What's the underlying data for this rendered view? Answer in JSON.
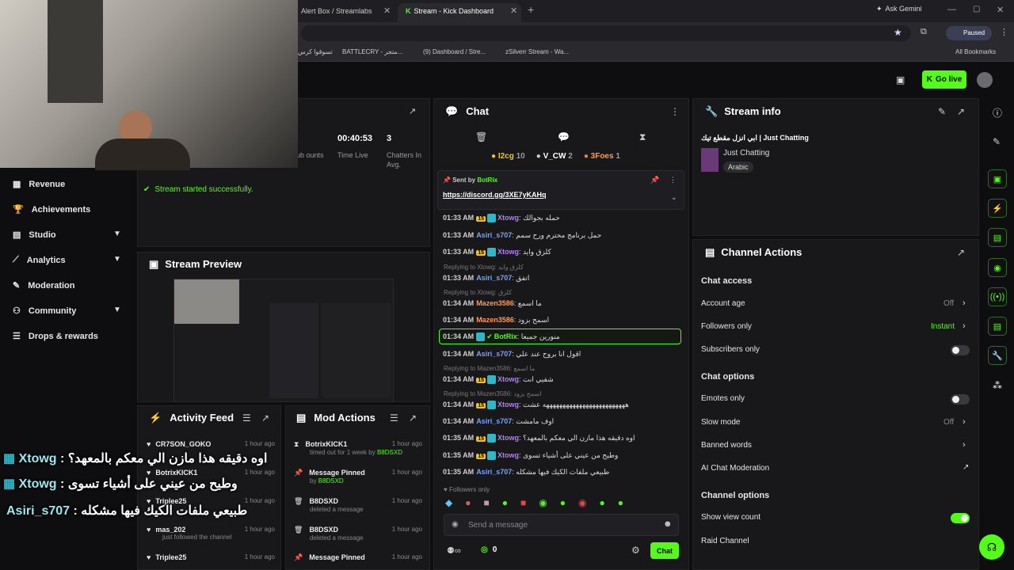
{
  "browser": {
    "tabs": [
      {
        "label": "Alert Box / Streamlabs"
      },
      {
        "label": "Stream - Kick Dashboard"
      }
    ],
    "ask_gemini": "Ask Gemini",
    "profile_status": "Paused",
    "bookmarks": [
      "تسوقوا كرس",
      "BATTLECRY - متجر...",
      "(9) Dashboard / Stre...",
      "zSilverr Stream - Wa..."
    ],
    "all_bookmarks": "All Bookmarks"
  },
  "header": {
    "go_live": "Go live"
  },
  "stats": {
    "time_value": "00:40:53",
    "time_label": "Time Live",
    "chatters_value": "3",
    "chatters_label": "Chatters In Avg.",
    "sub_label": "ub ounts"
  },
  "sidebar": {
    "items": [
      {
        "label": "Revenue"
      },
      {
        "label": "Achievements"
      },
      {
        "label": "Studio"
      },
      {
        "label": "Analytics"
      },
      {
        "label": "Moderation"
      },
      {
        "label": "Community"
      },
      {
        "label": "Drops & rewards"
      }
    ]
  },
  "notice": "Stream started successfully.",
  "preview": {
    "title": "Stream Preview"
  },
  "activity": {
    "title": "Activity Feed",
    "items": [
      {
        "name": "CR7SON_GOKO",
        "sub": "",
        "time": "1 hour ago"
      },
      {
        "name": "BotrixKICK1",
        "sub": "",
        "time": "1 hour ago"
      },
      {
        "name": "Triplee25",
        "sub": "",
        "time": "1 hour ago"
      },
      {
        "name": "mas_202",
        "sub": "just followed the channel",
        "time": "1 hour ago"
      },
      {
        "name": "Triplee25",
        "sub": "",
        "time": "1 hour ago"
      }
    ]
  },
  "modactions": {
    "title": "Mod Actions",
    "items": [
      {
        "name": "BotrixKICK1",
        "sub": "timed out for 1 week by",
        "by": "B8DSXD",
        "time": "1 hour ago"
      },
      {
        "name": "Message Pinned",
        "sub": "by",
        "by": "B8DSXD",
        "time": "1 hour ago"
      },
      {
        "name": "B8DSXD",
        "sub": "deleted a message",
        "by": "",
        "time": "1 hour ago"
      },
      {
        "name": "B8DSXD",
        "sub": "deleted a message",
        "by": "",
        "time": "1 hour ago"
      },
      {
        "name": "Message Pinned",
        "sub": "",
        "by": "",
        "time": "1 hour ago"
      }
    ]
  },
  "chat": {
    "title": "Chat",
    "leaders": [
      {
        "name": "I2cg",
        "count": "10"
      },
      {
        "name": "V_CW",
        "count": "2"
      },
      {
        "name": "3Foes",
        "count": "1"
      }
    ],
    "pinned": {
      "sent_by": "Sent by",
      "user": "BotRix",
      "link": "https://discord.gg/3XE7yKAHq"
    },
    "messages": [
      {
        "t": "01:33 AM",
        "u": "Xtowg",
        "c": "u1",
        "m": "حمله بجوالك",
        "b15": true
      },
      {
        "t": "01:33 AM",
        "u": "Asiri_s707",
        "c": "u2",
        "m": "حمل برنامج محترم ورح سمم",
        "b15": false
      },
      {
        "t": "01:33 AM",
        "u": "Xtowg",
        "c": "u1",
        "m": "كلزق وايد",
        "b15": true
      },
      {
        "t": "01:33 AM",
        "u": "Asiri_s707",
        "c": "u2",
        "m": "اتفق",
        "b15": false,
        "reply": "Replying to Xtowg: كلزق وايد"
      },
      {
        "t": "01:34 AM",
        "u": "Mazen3586",
        "c": "u3",
        "m": "ما اسمع",
        "b15": false,
        "reply": "Replying to Xtowg: كلزق"
      },
      {
        "t": "01:34 AM",
        "u": "Mazen3586",
        "c": "u3",
        "m": "اسمح بزود",
        "b15": false
      },
      {
        "t": "01:34 AM",
        "u": "BotRix",
        "c": "u4",
        "m": "منورين جميعا",
        "b15": false
      },
      {
        "t": "01:34 AM",
        "u": "Asiri_s707",
        "c": "u2",
        "m": "اقول انا بروح عند علي",
        "b15": false
      },
      {
        "t": "01:34 AM",
        "u": "Xtowg",
        "c": "u1",
        "m": "شفيي انت",
        "b15": true,
        "reply": "Replying to Mazen3586: ما اسمع"
      },
      {
        "t": "01:34 AM",
        "u": "Xtowg",
        "c": "u1",
        "m": "هههههههههههههههههههههههههه عشت",
        "b15": true,
        "reply": "Replying to Mazen3586: اسمح بزود"
      },
      {
        "t": "01:34 AM",
        "u": "Asiri_s707",
        "c": "u2",
        "m": "اوف مامشت",
        "b15": false
      },
      {
        "t": "01:35 AM",
        "u": "Xtowg",
        "c": "u1",
        "m": "اوه دقيقه هذا مازن الي معكم بالمعهد؟",
        "b15": true
      },
      {
        "t": "01:35 AM",
        "u": "Xtowg",
        "c": "u1",
        "m": "وطيح من عيني على أشياء تسوى",
        "b15": true
      },
      {
        "t": "01:35 AM",
        "u": "Asiri_s707",
        "c": "u2",
        "m": "طبيعي ملفات الكيك فيها مشكله",
        "b15": false
      }
    ],
    "followers_only": "Followers only",
    "placeholder": "Send a message",
    "points": "0",
    "send": "Chat"
  },
  "streaminfo": {
    "title": "Stream info",
    "stream_title": "ابي انزل مقطع تيك | Just Chatting",
    "category": "Just Chatting",
    "language": "Arabic"
  },
  "channel": {
    "title": "Channel Actions",
    "chat_access": "Chat access",
    "account_age": "Account age",
    "account_age_val": "Off",
    "followers_only": "Followers only",
    "followers_only_val": "Instant",
    "subscribers_only": "Subscribers only",
    "chat_options": "Chat options",
    "emotes_only": "Emotes only",
    "slow_mode": "Slow mode",
    "slow_mode_val": "Off",
    "banned_words": "Banned words",
    "ai_mod": "AI Chat Moderation",
    "channel_options": "Channel options",
    "show_view_count": "Show view count",
    "raid_channel": "Raid Channel"
  },
  "overlay": [
    {
      "user": "Xtowg",
      "msg": ": اوه دقيقه هذا مازن الي معكم بالمعهد؟"
    },
    {
      "user": "Xtowg",
      "msg": ": وطيح من عيني على أشياء تسوى"
    },
    {
      "user": "Asiri_s707",
      "msg": ": طبيعي ملفات الكيك فيها مشكله"
    }
  ],
  "colors": {
    "accent": "#53fc18",
    "panel": "#18181b",
    "bg": "#0e0e10"
  }
}
